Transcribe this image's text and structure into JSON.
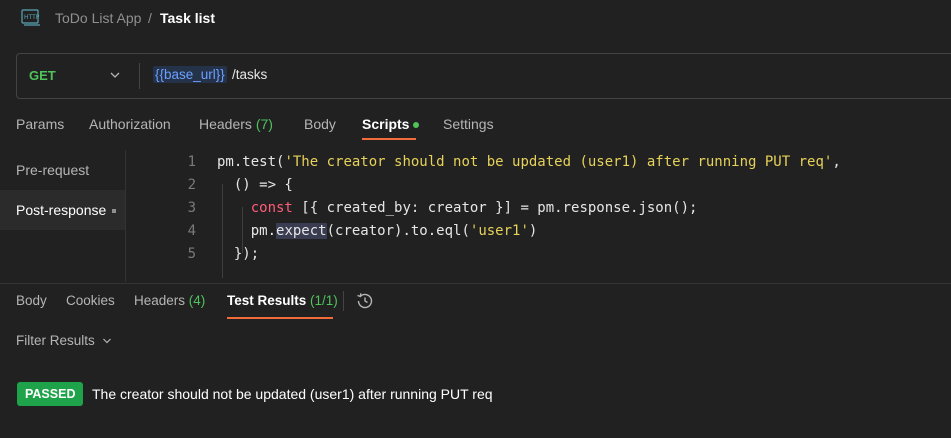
{
  "header": {
    "icon": "http-icon",
    "app_name": "ToDo List App",
    "separator": "/",
    "title": "Task list"
  },
  "request": {
    "method": "GET",
    "url_variable": "{{base_url}}",
    "url_path": "/tasks"
  },
  "request_tabs": [
    {
      "label": "Params"
    },
    {
      "label": "Authorization"
    },
    {
      "label": "Headers",
      "count": "(7)"
    },
    {
      "label": "Body"
    },
    {
      "label": "Scripts",
      "active": true
    },
    {
      "label": "Settings"
    }
  ],
  "script_nav": {
    "items": [
      {
        "label": "Pre-request"
      },
      {
        "label": "Post-response",
        "active": true
      }
    ]
  },
  "editor": {
    "line_numbers": [
      "1",
      "2",
      "3",
      "4",
      "5"
    ],
    "lines": [
      [
        {
          "t": "pm.test(",
          "c": "plain"
        },
        {
          "t": "'The creator should not be updated (user1) after running PUT req'",
          "c": "str"
        },
        {
          "t": ",",
          "c": "plain"
        }
      ],
      [
        {
          "t": "  () => {",
          "c": "plain"
        }
      ],
      [
        {
          "t": "    ",
          "c": "plain"
        },
        {
          "t": "const",
          "c": "kw"
        },
        {
          "t": " [{ created_by: creator }] = pm.response.json();",
          "c": "plain"
        }
      ],
      [
        {
          "t": "    pm.",
          "c": "plain"
        },
        {
          "t": "expect",
          "c": "hl"
        },
        {
          "t": "(creator).to.eql(",
          "c": "plain"
        },
        {
          "t": "'user1'",
          "c": "str"
        },
        {
          "t": ")",
          "c": "plain"
        }
      ],
      [
        {
          "t": "  });",
          "c": "plain"
        }
      ]
    ]
  },
  "response_tabs": [
    {
      "label": "Body"
    },
    {
      "label": "Cookies"
    },
    {
      "label": "Headers",
      "count": "(4)"
    },
    {
      "label": "Test Results",
      "count": "(1/1)",
      "active": true
    }
  ],
  "filter": {
    "label": "Filter Results"
  },
  "results": [
    {
      "status": "PASSED",
      "name": "The creator should not be updated (user1) after running PUT req"
    }
  ],
  "colors": {
    "accent": "#f26b3a",
    "pass": "#1fa34a",
    "method_get": "#4fc25b",
    "string": "#e6d25a",
    "keyword": "#ff5c7a",
    "variable": "#6ea0ff"
  }
}
